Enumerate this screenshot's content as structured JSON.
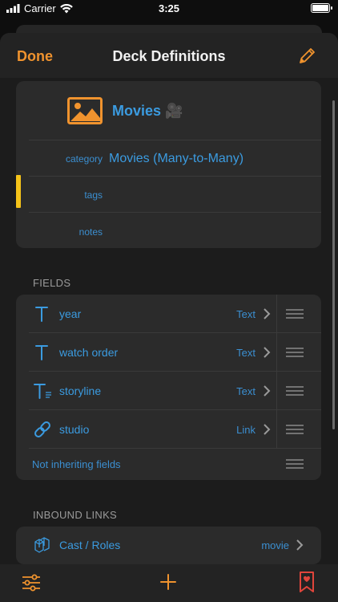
{
  "status_bar": {
    "carrier": "Carrier",
    "time": "3:25"
  },
  "nav": {
    "done_label": "Done",
    "title": "Deck Definitions",
    "edit_icon": "pencil-icon"
  },
  "deck": {
    "name": "Movies 🎥",
    "icon": "image-icon",
    "category_label": "category",
    "category_value": "Movies (Many-to-Many)",
    "tags_label": "tags",
    "notes_label": "notes"
  },
  "fields_section": {
    "title": "FIELDS",
    "items": [
      {
        "name": "year",
        "type": "Text",
        "icon": "text-type-icon"
      },
      {
        "name": "watch order",
        "type": "Text",
        "icon": "text-type-icon"
      },
      {
        "name": "storyline",
        "type": "Text",
        "icon": "long-text-type-icon"
      },
      {
        "name": "studio",
        "type": "Link",
        "icon": "link-type-icon"
      }
    ],
    "inherit_label": "Not inheriting fields"
  },
  "inbound_section": {
    "title": "INBOUND LINKS",
    "items": [
      {
        "name": "Cast / Roles",
        "field": "movie",
        "icon": "cube-stack-icon"
      }
    ]
  },
  "toolbar": {
    "filter_icon": "sliders-icon",
    "add_icon": "plus-icon",
    "bookmark_icon": "bookmark-icon"
  },
  "colors": {
    "accent_orange": "#f0932e",
    "link_blue": "#3b9be0",
    "marker_yellow": "#f5c319",
    "bookmark_red": "#e0453b"
  }
}
